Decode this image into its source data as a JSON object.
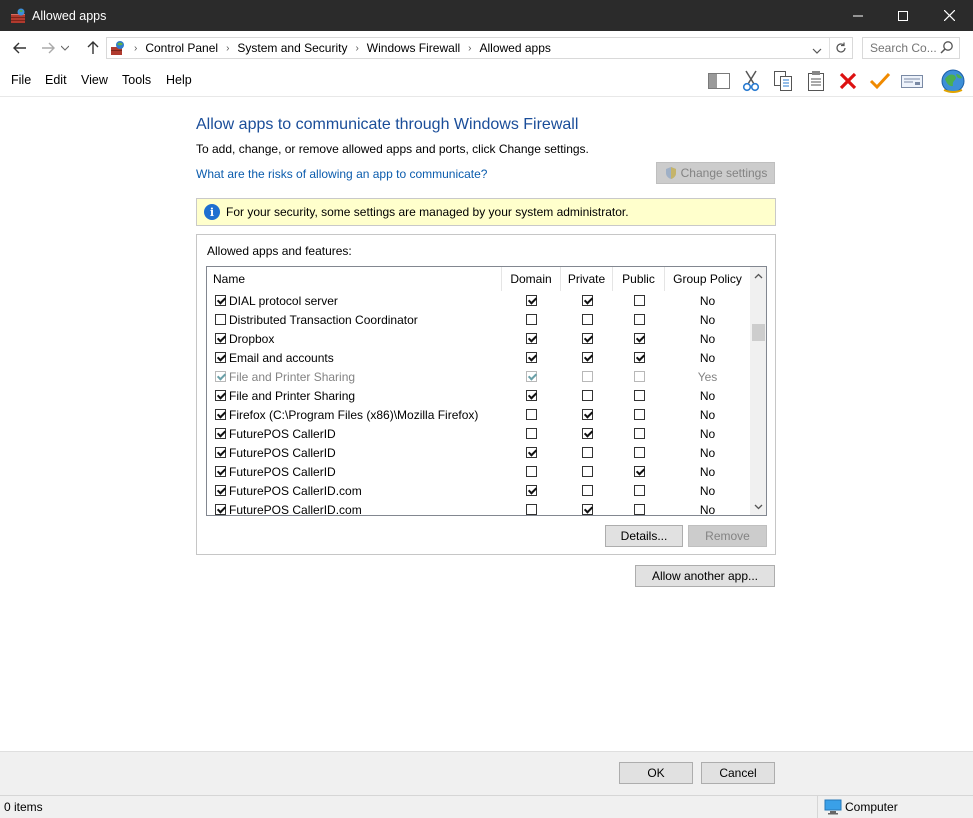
{
  "window": {
    "title": "Allowed apps",
    "minimize": "—",
    "maximize": "☐",
    "close": "✕"
  },
  "address": {
    "breadcrumbs": [
      "Control Panel",
      "System and Security",
      "Windows Firewall",
      "Allowed apps"
    ],
    "search_placeholder": "Search Co..."
  },
  "menu": {
    "file": "File",
    "edit": "Edit",
    "view": "View",
    "tools": "Tools",
    "help": "Help"
  },
  "toolbar_icons": [
    "layout-icon",
    "cut-icon",
    "copy-icon",
    "paste-icon",
    "delete-icon",
    "checkmark-icon",
    "properties-icon",
    "globe-icon"
  ],
  "page": {
    "heading": "Allow apps to communicate through Windows Firewall",
    "subtext": "To add, change, or remove allowed apps and ports, click Change settings.",
    "risk_link": "What are the risks of allowing an app to communicate?",
    "change_settings": "Change settings",
    "info_text": "For your security, some settings are managed by your system administrator.",
    "group_label": "Allowed apps and features:",
    "details_button": "Details...",
    "remove_button": "Remove",
    "allow_another_button": "Allow another app..."
  },
  "table": {
    "columns": [
      "Name",
      "Domain",
      "Private",
      "Public",
      "Group Policy"
    ],
    "rows": [
      {
        "name": "DIAL protocol server",
        "enabled": true,
        "domain": true,
        "private": true,
        "public": false,
        "group_policy": "No",
        "disabled": false
      },
      {
        "name": "Distributed Transaction Coordinator",
        "enabled": false,
        "domain": false,
        "private": false,
        "public": false,
        "group_policy": "No",
        "disabled": false
      },
      {
        "name": "Dropbox",
        "enabled": true,
        "domain": true,
        "private": true,
        "public": true,
        "group_policy": "No",
        "disabled": false
      },
      {
        "name": "Email and accounts",
        "enabled": true,
        "domain": true,
        "private": true,
        "public": true,
        "group_policy": "No",
        "disabled": false
      },
      {
        "name": "File and Printer Sharing",
        "enabled": true,
        "domain": true,
        "private": false,
        "public": false,
        "group_policy": "Yes",
        "disabled": true
      },
      {
        "name": "File and Printer Sharing",
        "enabled": true,
        "domain": true,
        "private": false,
        "public": false,
        "group_policy": "No",
        "disabled": false
      },
      {
        "name": "Firefox (C:\\Program Files (x86)\\Mozilla Firefox)",
        "enabled": true,
        "domain": false,
        "private": true,
        "public": false,
        "group_policy": "No",
        "disabled": false
      },
      {
        "name": "FuturePOS CallerID",
        "enabled": true,
        "domain": false,
        "private": true,
        "public": false,
        "group_policy": "No",
        "disabled": false
      },
      {
        "name": "FuturePOS CallerID",
        "enabled": true,
        "domain": true,
        "private": false,
        "public": false,
        "group_policy": "No",
        "disabled": false
      },
      {
        "name": "FuturePOS CallerID",
        "enabled": true,
        "domain": false,
        "private": false,
        "public": true,
        "group_policy": "No",
        "disabled": false
      },
      {
        "name": "FuturePOS CallerID.com",
        "enabled": true,
        "domain": true,
        "private": false,
        "public": false,
        "group_policy": "No",
        "disabled": false
      },
      {
        "name": "FuturePOS CallerID.com",
        "enabled": true,
        "domain": false,
        "private": true,
        "public": false,
        "group_policy": "No",
        "disabled": false
      }
    ]
  },
  "dialog": {
    "ok": "OK",
    "cancel": "Cancel"
  },
  "status": {
    "items": "0 items",
    "location": "Computer"
  },
  "colors": {
    "titlebar": "#2b2b2b",
    "heading": "#1a4d99",
    "link": "#0b5cad",
    "info_bg": "#ffffcc"
  }
}
